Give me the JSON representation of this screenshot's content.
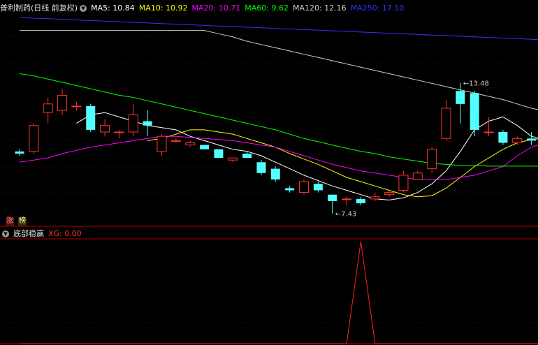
{
  "main_panel": {
    "title": "普利制药(日线 前复权)",
    "ma_labels": [
      {
        "text": "MA5: 10.84",
        "color": "#ffffff"
      },
      {
        "text": "MA10: 10.92",
        "color": "#ffff00"
      },
      {
        "text": "MA20: 10.71",
        "color": "#ff00ff"
      },
      {
        "text": "MA60: 9.62",
        "color": "#00ff00"
      },
      {
        "text": "MA120: 12.16",
        "color": "#cccccc"
      },
      {
        "text": "MA250: 17.10",
        "color": "#3333ff"
      }
    ],
    "tags": [
      {
        "text": "涨",
        "color": "#ff8080",
        "bg": "#551111"
      },
      {
        "text": "榜",
        "color": "#ffff99",
        "bg": "#333300"
      }
    ]
  },
  "sub_panel": {
    "title": "底部稳赢",
    "label": "XG: 0.00",
    "label_color": "#ff3333"
  },
  "chart_data": [
    {
      "type": "candlestick",
      "title": "普利制药(日线 前复权)",
      "annotations": [
        {
          "text": "←13.48",
          "at": "high",
          "index": 31
        },
        {
          "text": "←7.43",
          "at": "low",
          "index": 22
        }
      ],
      "ylim": [
        6.9,
        16.6
      ],
      "up_color": "#ff3232",
      "down_color": "#54ffff",
      "candles": [
        {
          "o": 10.3,
          "h": 10.4,
          "l": 10.1,
          "c": 10.2
        },
        {
          "o": 10.3,
          "h": 11.6,
          "l": 10.2,
          "c": 11.5
        },
        {
          "o": 12.1,
          "h": 12.8,
          "l": 11.6,
          "c": 12.5
        },
        {
          "o": 12.2,
          "h": 13.2,
          "l": 12.0,
          "c": 12.9
        },
        {
          "o": 12.4,
          "h": 12.6,
          "l": 12.2,
          "c": 12.4
        },
        {
          "o": 12.4,
          "h": 12.5,
          "l": 11.2,
          "c": 11.3
        },
        {
          "o": 11.2,
          "h": 11.8,
          "l": 11.0,
          "c": 11.5
        },
        {
          "o": 11.2,
          "h": 11.3,
          "l": 10.9,
          "c": 11.2
        },
        {
          "o": 11.2,
          "h": 12.5,
          "l": 11.0,
          "c": 12.0
        },
        {
          "o": 11.7,
          "h": 12.2,
          "l": 11.0,
          "c": 11.5
        },
        {
          "o": 10.3,
          "h": 11.1,
          "l": 10.1,
          "c": 11.0
        },
        {
          "o": 10.8,
          "h": 10.9,
          "l": 10.7,
          "c": 10.8
        },
        {
          "o": 10.6,
          "h": 10.8,
          "l": 10.5,
          "c": 10.7
        },
        {
          "o": 10.6,
          "h": 10.6,
          "l": 10.4,
          "c": 10.4
        },
        {
          "o": 10.4,
          "h": 10.4,
          "l": 10.0,
          "c": 10.0
        },
        {
          "o": 9.9,
          "h": 10.0,
          "l": 9.8,
          "c": 10.0
        },
        {
          "o": 10.2,
          "h": 10.3,
          "l": 10.1,
          "c": 10.0
        },
        {
          "o": 9.8,
          "h": 9.9,
          "l": 9.2,
          "c": 9.3
        },
        {
          "o": 9.5,
          "h": 9.6,
          "l": 8.9,
          "c": 9.0
        },
        {
          "o": 8.6,
          "h": 8.7,
          "l": 8.4,
          "c": 8.5
        },
        {
          "o": 8.4,
          "h": 9.0,
          "l": 8.3,
          "c": 8.9
        },
        {
          "o": 8.8,
          "h": 8.9,
          "l": 8.4,
          "c": 8.5
        },
        {
          "o": 8.3,
          "h": 8.3,
          "l": 7.43,
          "c": 8.0
        },
        {
          "o": 8.1,
          "h": 8.2,
          "l": 7.8,
          "c": 8.1
        },
        {
          "o": 8.1,
          "h": 8.2,
          "l": 7.8,
          "c": 7.9
        },
        {
          "o": 8.1,
          "h": 8.4,
          "l": 8.0,
          "c": 8.2
        },
        {
          "o": 8.3,
          "h": 8.5,
          "l": 8.2,
          "c": 8.4
        },
        {
          "o": 8.5,
          "h": 9.4,
          "l": 8.4,
          "c": 9.2
        },
        {
          "o": 9.0,
          "h": 9.4,
          "l": 9.0,
          "c": 9.3
        },
        {
          "o": 9.5,
          "h": 10.5,
          "l": 9.3,
          "c": 10.4
        },
        {
          "o": 10.9,
          "h": 12.7,
          "l": 10.8,
          "c": 12.3
        },
        {
          "o": 13.1,
          "h": 13.48,
          "l": 11.6,
          "c": 12.5
        },
        {
          "o": 13.0,
          "h": 13.1,
          "l": 11.0,
          "c": 11.3
        },
        {
          "o": 11.2,
          "h": 11.9,
          "l": 11.0,
          "c": 11.2
        },
        {
          "o": 11.2,
          "h": 11.3,
          "l": 10.6,
          "c": 10.7
        },
        {
          "o": 10.7,
          "h": 11.0,
          "l": 10.6,
          "c": 10.9
        },
        {
          "o": 10.9,
          "h": 11.2,
          "l": 10.6,
          "c": 10.8
        },
        {
          "o": 10.6,
          "h": 10.9,
          "l": 10.5,
          "c": 10.8
        }
      ],
      "moving_averages": [
        {
          "name": "MA5",
          "color": "#ffffff",
          "values": [
            null,
            null,
            null,
            null,
            11.6,
            12.0,
            12.1,
            11.9,
            11.7,
            11.5,
            11.4,
            11.3,
            11.0,
            10.8,
            10.6,
            10.4,
            10.3,
            10.1,
            9.8,
            9.5,
            9.2,
            8.95,
            8.7,
            8.5,
            8.3,
            8.1,
            8.05,
            8.15,
            8.4,
            8.8,
            9.4,
            10.3,
            11.3,
            11.7,
            11.9,
            11.5,
            11.0,
            10.84
          ]
        },
        {
          "name": "MA10",
          "color": "#ffff00",
          "values": [
            null,
            null,
            null,
            null,
            null,
            null,
            null,
            null,
            null,
            10.8,
            10.9,
            11.1,
            11.3,
            11.3,
            11.2,
            11.1,
            10.9,
            10.7,
            10.5,
            10.2,
            9.95,
            9.7,
            9.4,
            9.1,
            8.9,
            8.7,
            8.5,
            8.3,
            8.2,
            8.25,
            8.6,
            9.1,
            9.6,
            10.0,
            10.4,
            10.7,
            10.85,
            10.92
          ]
        },
        {
          "name": "MA20",
          "color": "#ff00ff",
          "values": [
            9.8,
            9.9,
            10.0,
            10.2,
            10.35,
            10.5,
            10.6,
            10.7,
            10.8,
            10.9,
            11.0,
            11.0,
            10.95,
            10.9,
            10.85,
            10.8,
            10.7,
            10.6,
            10.5,
            10.3,
            10.1,
            9.9,
            9.7,
            9.55,
            9.4,
            9.3,
            9.2,
            9.1,
            9.0,
            9.0,
            9.0,
            9.1,
            9.2,
            9.4,
            9.6,
            10.1,
            10.5,
            10.71
          ]
        },
        {
          "name": "MA60",
          "color": "#00ff00",
          "values": [
            13.9,
            13.8,
            13.65,
            13.5,
            13.35,
            13.2,
            13.05,
            12.9,
            12.8,
            12.65,
            12.5,
            12.35,
            12.2,
            12.05,
            11.9,
            11.75,
            11.6,
            11.45,
            11.3,
            11.1,
            10.9,
            10.75,
            10.6,
            10.45,
            10.3,
            10.2,
            10.05,
            9.95,
            9.85,
            9.75,
            9.7,
            9.65,
            9.65,
            9.62,
            9.62,
            9.62,
            9.62,
            9.62
          ]
        },
        {
          "name": "MA120",
          "color": "#cccccc",
          "values": [
            18.0,
            17.9,
            17.8,
            17.65,
            17.5,
            17.35,
            17.2,
            17.0,
            16.85,
            16.65,
            16.5,
            16.3,
            16.1,
            15.95,
            15.75,
            15.6,
            15.4,
            15.25,
            15.1,
            14.95,
            14.8,
            14.65,
            14.5,
            14.35,
            14.2,
            14.05,
            13.9,
            13.75,
            13.6,
            13.45,
            13.3,
            13.15,
            13.0,
            12.85,
            12.7,
            12.5,
            12.3,
            12.16
          ]
        },
        {
          "name": "MA250",
          "color": "#3333ff",
          "values": [
            24.9,
            24.8,
            24.7,
            24.6,
            24.5,
            24.4,
            24.3,
            24.2,
            24.1,
            24.0,
            23.9,
            23.8,
            23.7,
            23.6,
            23.5,
            23.4,
            23.3,
            23.2,
            23.1,
            23.0,
            22.9,
            22.8,
            22.7,
            22.6,
            22.5,
            22.4,
            22.3,
            22.2,
            22.1,
            22.0,
            21.9,
            21.8,
            21.7,
            21.6,
            21.5,
            21.4,
            21.2,
            17.1
          ]
        }
      ]
    },
    {
      "type": "line",
      "title": "底部稳赢",
      "series": [
        {
          "name": "XG",
          "color": "#ff2020",
          "values": [
            0,
            0,
            0,
            0,
            0,
            0,
            0,
            0,
            0,
            0,
            0,
            0,
            0,
            0,
            0,
            0,
            0,
            0,
            0,
            0,
            0,
            0,
            0,
            0,
            1,
            0,
            0,
            0,
            0,
            0,
            0,
            0,
            0,
            0,
            0,
            0,
            0,
            0
          ]
        }
      ],
      "ylim": [
        0,
        1
      ]
    }
  ]
}
